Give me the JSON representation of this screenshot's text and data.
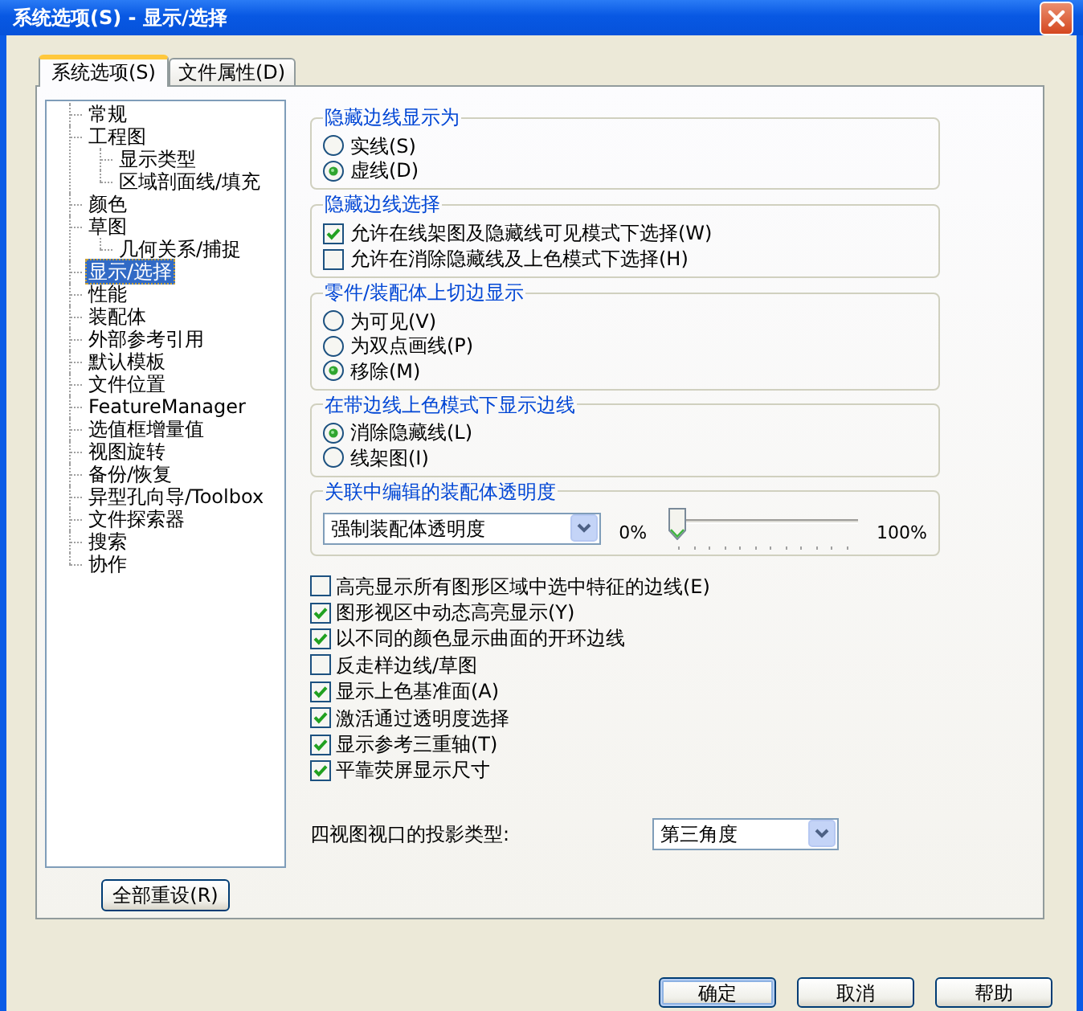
{
  "window": {
    "title": "系统选项(S) - 显示/选择"
  },
  "tabs": [
    {
      "label": "系统选项(S)",
      "selected": true
    },
    {
      "label": "文件属性(D)",
      "selected": false
    }
  ],
  "sidebar": {
    "items": [
      {
        "label": "常规",
        "selected": false
      },
      {
        "label": "工程图",
        "selected": false,
        "children": [
          {
            "label": "显示类型",
            "selected": false
          },
          {
            "label": "区域剖面线/填充",
            "selected": false
          }
        ]
      },
      {
        "label": "颜色",
        "selected": false
      },
      {
        "label": "草图",
        "selected": false,
        "children": [
          {
            "label": "几何关系/捕捉",
            "selected": false
          }
        ]
      },
      {
        "label": "显示/选择",
        "selected": true
      },
      {
        "label": "性能",
        "selected": false
      },
      {
        "label": "装配体",
        "selected": false
      },
      {
        "label": "外部参考引用",
        "selected": false
      },
      {
        "label": "默认模板",
        "selected": false
      },
      {
        "label": "文件位置",
        "selected": false
      },
      {
        "label": "FeatureManager",
        "selected": false
      },
      {
        "label": "选值框增量值",
        "selected": false
      },
      {
        "label": "视图旋转",
        "selected": false
      },
      {
        "label": "备份/恢复",
        "selected": false
      },
      {
        "label": "异型孔向导/Toolbox",
        "selected": false
      },
      {
        "label": "文件探索器",
        "selected": false
      },
      {
        "label": "搜索",
        "selected": false
      },
      {
        "label": "协作",
        "selected": false
      }
    ],
    "reset_button": "全部重设(R)"
  },
  "groups": [
    {
      "kind": "radios",
      "title": "隐藏边线显示为",
      "options": [
        {
          "label": "实线(S)",
          "selected": false
        },
        {
          "label": "虚线(D)",
          "selected": true
        }
      ]
    },
    {
      "kind": "checkboxes",
      "title": "隐藏边线选择",
      "options": [
        {
          "label": "允许在线架图及隐藏线可见模式下选择(W)",
          "checked": true
        },
        {
          "label": "允许在消除隐藏线及上色模式下选择(H)",
          "checked": false
        }
      ]
    },
    {
      "kind": "radios",
      "title": "零件/装配体上切边显示",
      "options": [
        {
          "label": "为可见(V)",
          "selected": false
        },
        {
          "label": "为双点画线(P)",
          "selected": false
        },
        {
          "label": "移除(M)",
          "selected": true
        }
      ]
    },
    {
      "kind": "radios",
      "title": "在带边线上色模式下显示边线",
      "options": [
        {
          "label": "消除隐藏线(L)",
          "selected": true
        },
        {
          "label": "线架图(I)",
          "selected": false
        }
      ]
    },
    {
      "kind": "transparency",
      "title": "关联中编辑的装配体透明度",
      "dropdown": {
        "value": "强制装配体透明度"
      },
      "slider": {
        "min_label": "0%",
        "max_label": "100%",
        "level": 0
      }
    }
  ],
  "options": [
    {
      "label": "高亮显示所有图形区域中选中特征的边线(E)",
      "checked": false
    },
    {
      "label": "图形视区中动态高亮显示(Y)",
      "checked": true
    },
    {
      "label": "以不同的颜色显示曲面的开环边线",
      "checked": true
    },
    {
      "label": "反走样边线/草图",
      "checked": false
    },
    {
      "label": "显示上色基准面(A)",
      "checked": true
    },
    {
      "label": "激活通过透明度选择",
      "checked": true
    },
    {
      "label": "显示参考三重轴(T)",
      "checked": true
    },
    {
      "label": "平靠荧屏显示尺寸",
      "checked": true
    }
  ],
  "projection": {
    "label": "四视图视口的投影类型:",
    "value": "第三角度"
  },
  "buttons": [
    {
      "label": "确定",
      "default": true
    },
    {
      "label": "取消",
      "default": false
    },
    {
      "label": "帮助",
      "default": false
    }
  ]
}
